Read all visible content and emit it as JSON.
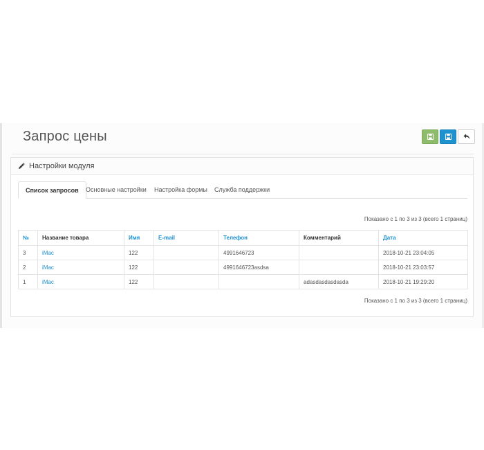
{
  "page": {
    "title": "Запрос цены"
  },
  "toolbar": {
    "buttons": [
      {
        "name": "save-button-green",
        "color": "#8fbb6c",
        "icon": "floppy-disk-icon"
      },
      {
        "name": "save-button-blue",
        "color": "#1e91cf",
        "icon": "floppy-disk-icon"
      },
      {
        "name": "back-button",
        "color": "#ffffff",
        "icon": "reply-arrow-icon"
      }
    ]
  },
  "panel": {
    "title": "Настройки модуля",
    "icon": "pencil-icon",
    "tabs": [
      {
        "label": "Список запросов",
        "active": true
      },
      {
        "label": "Основные настройки",
        "active": false
      },
      {
        "label": "Настройка формы",
        "active": false
      },
      {
        "label": "Служба поддержки",
        "active": false
      }
    ],
    "summary_top": "Показано с 1 по 3 из 3 (всего 1 страниц)",
    "summary_bottom": "Показано с 1 по 3 из 3 (всего 1 страниц)"
  },
  "table": {
    "headers": [
      {
        "label": "№",
        "link": true
      },
      {
        "label": "Название товара",
        "link": false
      },
      {
        "label": "Имя",
        "link": true
      },
      {
        "label": "E-mail",
        "link": true
      },
      {
        "label": "Телефон",
        "link": true
      },
      {
        "label": "Комментарий",
        "link": false
      },
      {
        "label": "Дата",
        "link": true
      }
    ],
    "rows": [
      {
        "num": "3",
        "product": "iMac",
        "name": "122",
        "email": "",
        "phone": "4991646723",
        "comment": "",
        "date": "2018-10-21 23:04:05"
      },
      {
        "num": "2",
        "product": "iMac",
        "name": "122",
        "email": "",
        "phone": "4991646723asdsa",
        "comment": "",
        "date": "2018-10-21 23:03:57"
      },
      {
        "num": "1",
        "product": "iMac",
        "name": "122",
        "email": "",
        "phone": "",
        "comment": "adasdasdasdasda",
        "date": "2018-10-21 19:29:20"
      }
    ]
  },
  "colors": {
    "accent": "#1e91cf",
    "success": "#8fbb6c"
  }
}
